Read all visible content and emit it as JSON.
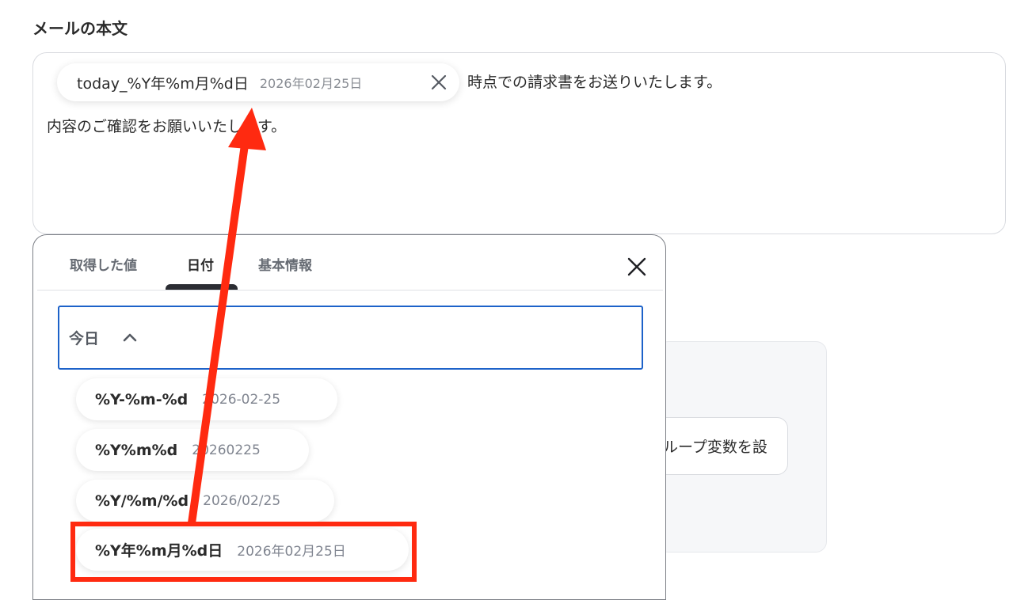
{
  "section": {
    "label": "メールの本文"
  },
  "editor": {
    "chip": {
      "label": "today_%Y年%m月%d日",
      "value": "2026年02月25日"
    },
    "line1_text": "時点での請求書をお送りいたします。",
    "line2_text": "内容のご確認をお願いいたします。"
  },
  "background": {
    "loop_button_label": "ループ変数を設"
  },
  "popup": {
    "tabs": [
      {
        "label": "取得した値"
      },
      {
        "label": "日付"
      },
      {
        "label": "基本情報"
      }
    ],
    "active_tab": "日付",
    "select": {
      "label": "今日"
    },
    "options": [
      {
        "format": "%Y-%m-%d",
        "value": "2026-02-25"
      },
      {
        "format": "%Y%m%d",
        "value": "20260225"
      },
      {
        "format": "%Y/%m/%d",
        "value": "2026/02/25"
      },
      {
        "format": "%Y年%m月%d日",
        "value": "2026年02月25日"
      }
    ]
  },
  "colors": {
    "annotation": "#ff2a10",
    "select_border": "#1d62c9"
  },
  "icons": {
    "chip_close": "close-icon",
    "popup_close": "close-icon",
    "select_toggle": "chevron-up-icon"
  }
}
